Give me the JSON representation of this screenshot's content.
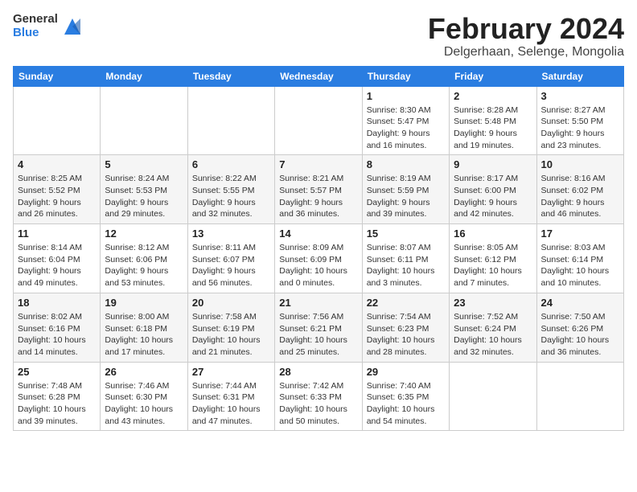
{
  "header": {
    "logo_general": "General",
    "logo_blue": "Blue",
    "month_year": "February 2024",
    "location": "Delgerhaan, Selenge, Mongolia"
  },
  "weekdays": [
    "Sunday",
    "Monday",
    "Tuesday",
    "Wednesday",
    "Thursday",
    "Friday",
    "Saturday"
  ],
  "weeks": [
    [
      {
        "day": "",
        "info": ""
      },
      {
        "day": "",
        "info": ""
      },
      {
        "day": "",
        "info": ""
      },
      {
        "day": "",
        "info": ""
      },
      {
        "day": "1",
        "info": "Sunrise: 8:30 AM\nSunset: 5:47 PM\nDaylight: 9 hours\nand 16 minutes."
      },
      {
        "day": "2",
        "info": "Sunrise: 8:28 AM\nSunset: 5:48 PM\nDaylight: 9 hours\nand 19 minutes."
      },
      {
        "day": "3",
        "info": "Sunrise: 8:27 AM\nSunset: 5:50 PM\nDaylight: 9 hours\nand 23 minutes."
      }
    ],
    [
      {
        "day": "4",
        "info": "Sunrise: 8:25 AM\nSunset: 5:52 PM\nDaylight: 9 hours\nand 26 minutes."
      },
      {
        "day": "5",
        "info": "Sunrise: 8:24 AM\nSunset: 5:53 PM\nDaylight: 9 hours\nand 29 minutes."
      },
      {
        "day": "6",
        "info": "Sunrise: 8:22 AM\nSunset: 5:55 PM\nDaylight: 9 hours\nand 32 minutes."
      },
      {
        "day": "7",
        "info": "Sunrise: 8:21 AM\nSunset: 5:57 PM\nDaylight: 9 hours\nand 36 minutes."
      },
      {
        "day": "8",
        "info": "Sunrise: 8:19 AM\nSunset: 5:59 PM\nDaylight: 9 hours\nand 39 minutes."
      },
      {
        "day": "9",
        "info": "Sunrise: 8:17 AM\nSunset: 6:00 PM\nDaylight: 9 hours\nand 42 minutes."
      },
      {
        "day": "10",
        "info": "Sunrise: 8:16 AM\nSunset: 6:02 PM\nDaylight: 9 hours\nand 46 minutes."
      }
    ],
    [
      {
        "day": "11",
        "info": "Sunrise: 8:14 AM\nSunset: 6:04 PM\nDaylight: 9 hours\nand 49 minutes."
      },
      {
        "day": "12",
        "info": "Sunrise: 8:12 AM\nSunset: 6:06 PM\nDaylight: 9 hours\nand 53 minutes."
      },
      {
        "day": "13",
        "info": "Sunrise: 8:11 AM\nSunset: 6:07 PM\nDaylight: 9 hours\nand 56 minutes."
      },
      {
        "day": "14",
        "info": "Sunrise: 8:09 AM\nSunset: 6:09 PM\nDaylight: 10 hours\nand 0 minutes."
      },
      {
        "day": "15",
        "info": "Sunrise: 8:07 AM\nSunset: 6:11 PM\nDaylight: 10 hours\nand 3 minutes."
      },
      {
        "day": "16",
        "info": "Sunrise: 8:05 AM\nSunset: 6:12 PM\nDaylight: 10 hours\nand 7 minutes."
      },
      {
        "day": "17",
        "info": "Sunrise: 8:03 AM\nSunset: 6:14 PM\nDaylight: 10 hours\nand 10 minutes."
      }
    ],
    [
      {
        "day": "18",
        "info": "Sunrise: 8:02 AM\nSunset: 6:16 PM\nDaylight: 10 hours\nand 14 minutes."
      },
      {
        "day": "19",
        "info": "Sunrise: 8:00 AM\nSunset: 6:18 PM\nDaylight: 10 hours\nand 17 minutes."
      },
      {
        "day": "20",
        "info": "Sunrise: 7:58 AM\nSunset: 6:19 PM\nDaylight: 10 hours\nand 21 minutes."
      },
      {
        "day": "21",
        "info": "Sunrise: 7:56 AM\nSunset: 6:21 PM\nDaylight: 10 hours\nand 25 minutes."
      },
      {
        "day": "22",
        "info": "Sunrise: 7:54 AM\nSunset: 6:23 PM\nDaylight: 10 hours\nand 28 minutes."
      },
      {
        "day": "23",
        "info": "Sunrise: 7:52 AM\nSunset: 6:24 PM\nDaylight: 10 hours\nand 32 minutes."
      },
      {
        "day": "24",
        "info": "Sunrise: 7:50 AM\nSunset: 6:26 PM\nDaylight: 10 hours\nand 36 minutes."
      }
    ],
    [
      {
        "day": "25",
        "info": "Sunrise: 7:48 AM\nSunset: 6:28 PM\nDaylight: 10 hours\nand 39 minutes."
      },
      {
        "day": "26",
        "info": "Sunrise: 7:46 AM\nSunset: 6:30 PM\nDaylight: 10 hours\nand 43 minutes."
      },
      {
        "day": "27",
        "info": "Sunrise: 7:44 AM\nSunset: 6:31 PM\nDaylight: 10 hours\nand 47 minutes."
      },
      {
        "day": "28",
        "info": "Sunrise: 7:42 AM\nSunset: 6:33 PM\nDaylight: 10 hours\nand 50 minutes."
      },
      {
        "day": "29",
        "info": "Sunrise: 7:40 AM\nSunset: 6:35 PM\nDaylight: 10 hours\nand 54 minutes."
      },
      {
        "day": "",
        "info": ""
      },
      {
        "day": "",
        "info": ""
      }
    ]
  ]
}
